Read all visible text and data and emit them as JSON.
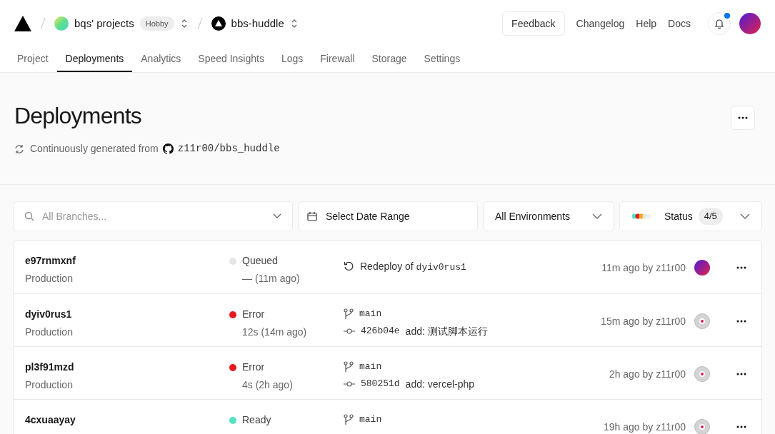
{
  "header": {
    "team": "bqs' projects",
    "plan": "Hobby",
    "project": "bbs-huddle",
    "buttons": [
      "Feedback"
    ],
    "links": [
      "Changelog",
      "Help",
      "Docs"
    ],
    "notification": true
  },
  "tabs": [
    {
      "label": "Project",
      "selected": false
    },
    {
      "label": "Deployments",
      "selected": true
    },
    {
      "label": "Analytics",
      "selected": false
    },
    {
      "label": "Speed Insights",
      "selected": false
    },
    {
      "label": "Logs",
      "selected": false
    },
    {
      "label": "Firewall",
      "selected": false
    },
    {
      "label": "Storage",
      "selected": false
    },
    {
      "label": "Settings",
      "selected": false
    }
  ],
  "page": {
    "title": "Deployments",
    "subtitle": "Continuously generated from",
    "repo": "z11r00/bbs_huddle"
  },
  "filters": {
    "branch_placeholder": "All Branches...",
    "date": "Select Date Range",
    "environment": "All Environments",
    "status": "Status",
    "status_count": "4/5"
  },
  "deployments": [
    {
      "id": "e97rnmxnf",
      "environment": "Production",
      "status": "Queued",
      "color": "#e5e5e5",
      "duration": "— (11m ago)",
      "kind": "redeploy",
      "source": "Redeploy of",
      "source_ref": "dyiv0rus1",
      "time": "11m ago by z11r00",
      "avatar": {
        "kind": "gradient"
      }
    },
    {
      "id": "dyiv0rus1",
      "environment": "Production",
      "status": "Error",
      "color": "#e5191d",
      "duration": "12s (14m ago)",
      "kind": "commit",
      "branch": "main",
      "commit": "426b04e",
      "message": "add: 测试脚本运行",
      "time": "15m ago by z11r00",
      "avatar": {
        "kind": "face"
      }
    },
    {
      "id": "pl3f91mzd",
      "environment": "Production",
      "status": "Error",
      "color": "#e5191d",
      "duration": "4s (2h ago)",
      "kind": "commit",
      "branch": "main",
      "commit": "580251d",
      "message": "add: vercel-php",
      "time": "2h ago by z11r00",
      "avatar": {
        "kind": "face"
      }
    },
    {
      "id": "4cxuaayay",
      "status": "Ready",
      "color": "#50e3c2",
      "kind": "commit",
      "branch": "main",
      "time": "19h ago by z11r00",
      "avatar": {
        "kind": "face"
      }
    }
  ]
}
